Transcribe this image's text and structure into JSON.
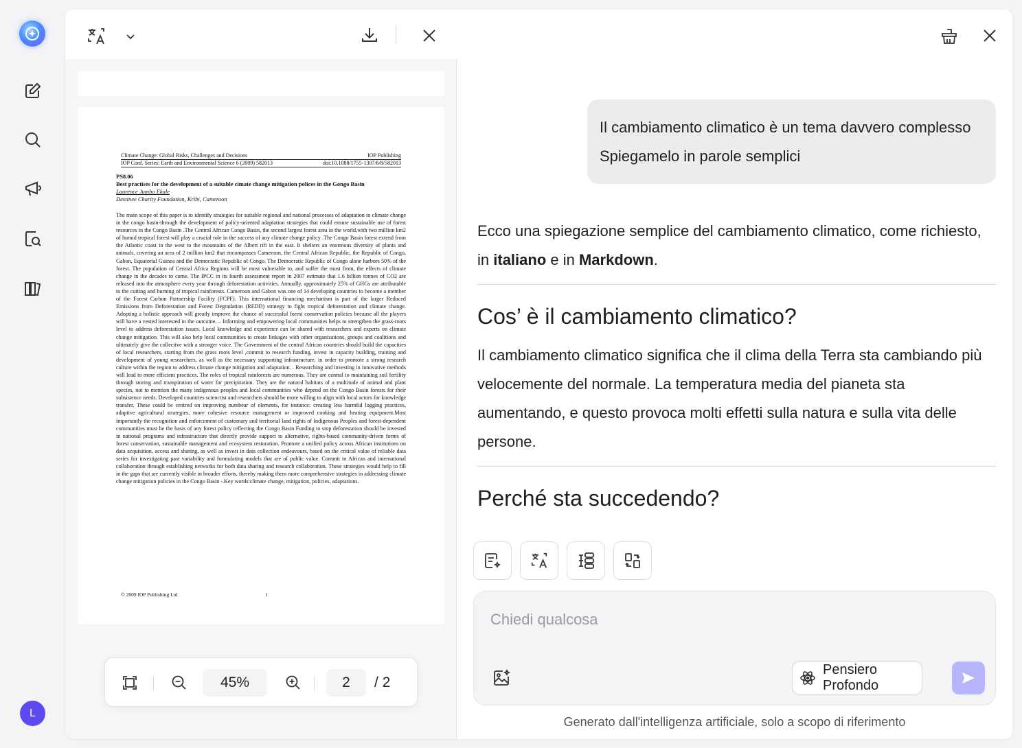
{
  "pdf": {
    "header_left_1": "Climate Change: Global Risks, Challenges and Decisions",
    "header_right_1": "IOP Publishing",
    "header_left_2": "IOP Conf. Series: Earth and Environmental Science 6 (2009) 582013",
    "header_right_2": "doi:10.1088/1755-1307/6/8/582013",
    "code": "PS8.06",
    "title": "Best practises for the development of a suitable cimate change mitigation polices in the Gongo Basin",
    "author": "Laurence Jumbo Ekale",
    "affiliation": "Destinee Charity Foundation, Kribi, Cameroon",
    "body": "The main scope of this paper is to identify  strategies for suitable regional and national processes of adaptation to climate change in the congo basin-through the development of policy-oriented adaptation strategies that could ensure sustainable use of forest resources in the Congo Basin .The Central African Congo Basin, the second largest forest area in the world,with two million km2 of humid tropical forest will play a crucial role in the success of any climate change policy .The Congo Basin forest extend from the Atlantic coast in the west to the mountains of the Albert rift in the east. It shelters an enormous diversity of plants and animals, covering an area of 2 million km2 that encompasses Cameroon, the Central African Republic, the Republic of Congo, Gabon, Equatorial Guinea and the Democratic Republic of Congo. The Democratic Republic of Congo alone harbors 50% of the forest. The population of Central Africa Regions will be most vulnerable to, and suffer the most from, the effects of climate change in the decades to come. The IPCC in its fourth assessment report in 2007 estimate that 1.6 billion tonnes of CO2 are released into the atmosphere every year through deforestation activities. Annually, approximately 25% of GHGs are attributable to the cutting and burning of tropical rainforests. Cameroon and Gabon was one of 14 developing countries to become a member of the Forest Carbon Partnership Facility (FCPF). This international financing mechanism is part of the larger Reduced Emissions from Deforestation and Forest Degradation (REDD) strategy to fight tropical deforestation and climate change. Adopting a holistic approach will greatly improve the chance of successful forest conservation policies because all the players will have a vested interested in the outcome. – Informing and empowering local communities helps to strengthen the grass-roots level to address deforestation issues. Local knowledge and experience can be shared with researchers and experts on climate change mitigation. This will also help local communities to create linkages with other organizations, groups and coalitions and ultimately give the collective with a stronger voice. The Government of the central African countries should build  the capacities of local researchers,  starting from the grass roots level ,commit to research funding, invest in capacity building, training and development of young researchers, as well as the necessary supporting infrastructure, in order to promote a strong research culture within the region to address climate change mitigation and adaptation. . Researching and investing in innovative methods  will lead to more efficient practices. The roles of tropical rainforests are numerous. They are central to maintaining soil fertility through storing and transpiration of water for precipitation. They are the natural habitats of a multitude of animal and plant species, not to mention the many indigenous peoples and local communities who depend on the Congo Basin forests for their subsistence needs. Developed countries scienctist and researchers should be more willing to align with local actors for knowledge transfer. These could be centred on improving  numbear of elements, for instance: creating less harmful logging practices, adaptive agricultural strategies, more cohesive resource management or improved cooking and heating equipment.Most importantly  the recognition and enforcement of customary and territorial land rights of Indigenous Peoples and forest-dependent communities must be the basis of any forest policy reflecting the Congo Basin Funding to stop deforestation should be invested in national programs and infrastructure that directly provide support to alternative, rights-based community-driven forms of forest conservation, sustainable management and ecosystem restoration. Promote a unified policy across African institutions on data acquisition, access and sharing, as well as invest in data collection endeavours, based on the critical value of reliable data series for investigating past variability and formulating models that are of public value. Commit to African and international collaboration through establishing networks for both data sharing and research collaboration. These strategies would help to fill in the gaps that are currently visible in broader efforts, thereby making them more comprehensive strategies in addressing climate change mitigation policies in the Congo Basin   -.Key words:climate change, mitigation, policies, adaptations.",
    "footer": "© 2009 IOP Publishing Ltd",
    "footer_page": "1"
  },
  "zoom": {
    "value": "45%",
    "page_current": "2",
    "page_total": "/ 2"
  },
  "chat": {
    "user_line_1": "Il cambiamento climatico è un tema davvero complesso",
    "user_line_2": "Spiegamelo in parole semplici",
    "intro_prefix": "Ecco una spiegazione semplice del cambiamento climatico, come richiesto, in ",
    "intro_bold_1": "italiano",
    "intro_mid": " e in ",
    "intro_bold_2": "Markdown",
    "intro_suffix": ".",
    "heading_1": "Cos’  è il cambiamento climatico?",
    "paragraph_1": "Il cambiamento climatico significa che il clima della Terra sta cambiando più velocemente del normale. La temperatura media del pianeta sta aumentando, e questo provoca molti effetti sulla natura e sulla vita delle persone.",
    "heading_2": "Perché sta succedendo?"
  },
  "composer": {
    "placeholder": "Chiedi qualcosa",
    "deep_think_label": "Pensiero Profondo"
  },
  "disclaimer": "Generato dall'intelligenza artificiale, solo a scopo di riferimento",
  "user": {
    "avatar_letter": "L"
  },
  "colors": {
    "accent": "#5a4bf0",
    "send_button": "#b6b4fb"
  }
}
